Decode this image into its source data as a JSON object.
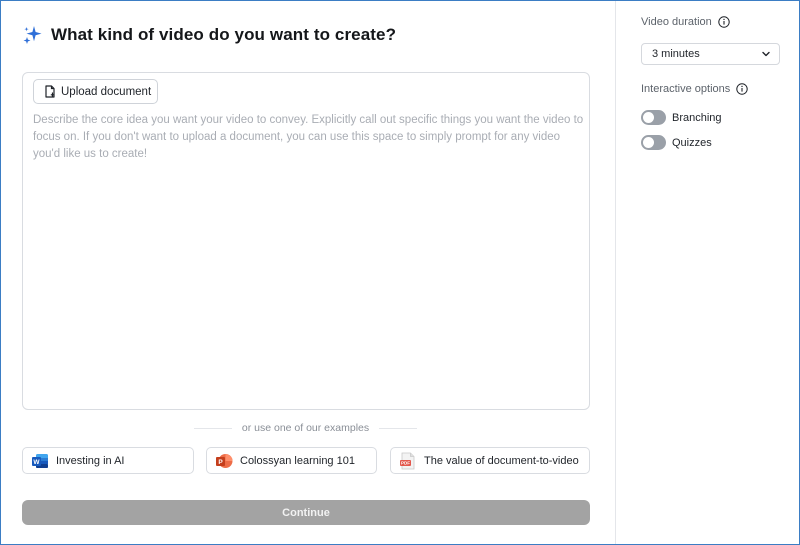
{
  "main": {
    "title": "What kind of video do you want to create?",
    "upload_button": "Upload document",
    "prompt_placeholder": "Describe the core idea you want your video to convey. Explicitly call out specific things you want the video to focus on. If you don't want to upload a document, you can use this space to simply prompt for any video you'd like us to create!",
    "examples_divider": "or use one of our examples",
    "examples": [
      {
        "label": "Investing in AI",
        "icon": "word-doc-icon"
      },
      {
        "label": "Colossyan learning 101",
        "icon": "powerpoint-icon"
      },
      {
        "label": "The value of document-to-video",
        "icon": "pdf-icon"
      }
    ],
    "continue_button": "Continue"
  },
  "sidebar": {
    "duration_label": "Video duration",
    "duration_value": "3 minutes",
    "interactive_label": "Interactive options",
    "toggles": [
      {
        "label": "Branching",
        "on": false
      },
      {
        "label": "Quizzes",
        "on": false
      }
    ]
  },
  "colors": {
    "accent": "#2f6fd8",
    "continue_disabled": "#a3a3a3",
    "toggle_off": "#9aa0a8"
  }
}
